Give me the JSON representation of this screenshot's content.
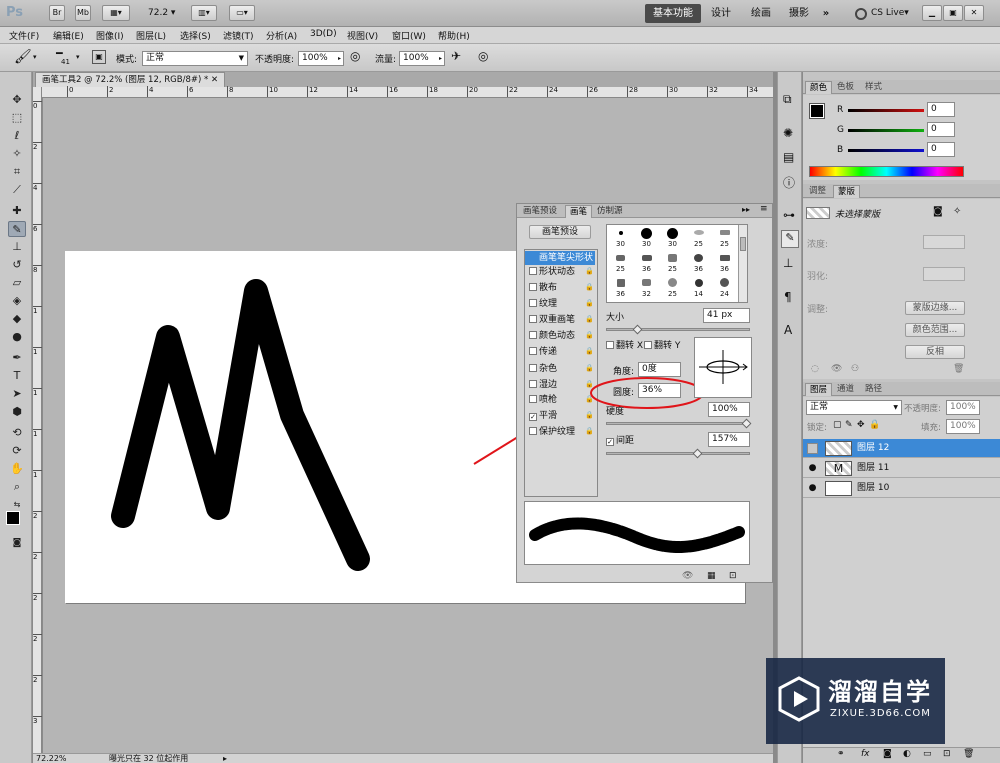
{
  "app": {
    "logo": "Ps",
    "zoom": "72.2",
    "workspaces": [
      "基本功能",
      "设计",
      "绘画",
      "摄影"
    ],
    "more_label": "»",
    "cs_live": "CS Live"
  },
  "menu": [
    "文件(F)",
    "编辑(E)",
    "图像(I)",
    "图层(L)",
    "选择(S)",
    "滤镜(T)",
    "分析(A)",
    "3D(D)",
    "视图(V)",
    "窗口(W)",
    "帮助(H)"
  ],
  "options": {
    "brush_size": "41",
    "mode_label": "模式:",
    "mode_value": "正常",
    "opacity_label": "不透明度:",
    "opacity_value": "100%",
    "flow_label": "流量:",
    "flow_value": "100%"
  },
  "document": {
    "tab_title": "画笔工具2 @ 72.2% (图层 12, RGB/8#) *",
    "ruler_marks": [
      "0",
      "2",
      "4",
      "6",
      "8",
      "10",
      "12",
      "14",
      "16",
      "18",
      "20",
      "22",
      "24",
      "26",
      "28",
      "30",
      "32",
      "34"
    ],
    "vruler_marks": [
      "0",
      "2",
      "4",
      "6",
      "8",
      "1",
      "1",
      "1",
      "1",
      "1",
      "2",
      "2",
      "2",
      "2",
      "2",
      "3"
    ],
    "status_zoom": "72.22%",
    "status_text": "曝光只在 32 位起作用"
  },
  "brush_panel": {
    "tabs": [
      "画笔预设",
      "画笔",
      "仿制源"
    ],
    "presets_button": "画笔预设",
    "options": [
      {
        "label": "画笔笔尖形状",
        "checked": false,
        "selected": true
      },
      {
        "label": "形状动态",
        "checked": false
      },
      {
        "label": "散布",
        "checked": false
      },
      {
        "label": "纹理",
        "checked": false
      },
      {
        "label": "双重画笔",
        "checked": false
      },
      {
        "label": "颜色动态",
        "checked": false
      },
      {
        "label": "传递",
        "checked": false
      },
      {
        "label": "杂色",
        "checked": false
      },
      {
        "label": "湿边",
        "checked": false
      },
      {
        "label": "喷枪",
        "checked": false
      },
      {
        "label": "平滑",
        "checked": true
      },
      {
        "label": "保护纹理",
        "checked": false
      }
    ],
    "tip_sizes": [
      "30",
      "30",
      "30",
      "25",
      "25",
      "25",
      "36",
      "25",
      "36",
      "36",
      "36",
      "32",
      "25",
      "14",
      "24"
    ],
    "size_label": "大小",
    "size_value": "41 px",
    "flip_x": "翻转 X",
    "flip_y": "翻转 Y",
    "angle_label": "角度:",
    "angle_value": "0度",
    "roundness_label": "圆度:",
    "roundness_value": "36%",
    "hardness_label": "硬度",
    "hardness_value": "100%",
    "spacing_label": "间距",
    "spacing_value": "157%",
    "size_fraction": 0.2,
    "hardness_fraction": 1.0,
    "spacing_fraction": 0.64
  },
  "color_panel": {
    "tabs": [
      "颜色",
      "色板",
      "样式"
    ],
    "channels": [
      {
        "label": "R",
        "value": "0",
        "color": "#d01010"
      },
      {
        "label": "G",
        "value": "0",
        "color": "#10b010"
      },
      {
        "label": "B",
        "value": "0",
        "color": "#1010d0"
      }
    ]
  },
  "masks_panel": {
    "tabs": [
      "调整",
      "蒙版"
    ],
    "no_mask": "未选择蒙版",
    "density": "浓度:",
    "feather": "羽化:",
    "refine": "调整:",
    "mask_edge": "蒙版边缘...",
    "color_range": "颜色范围...",
    "invert": "反相"
  },
  "layers_panel": {
    "tabs": [
      "图层",
      "通道",
      "路径"
    ],
    "blend_mode": "正常",
    "opacity_label": "不透明度:",
    "opacity_value": "100%",
    "lock_label": "锁定:",
    "fill_label": "填充:",
    "fill_value": "100%",
    "layers": [
      {
        "name": "图层 12",
        "selected": true,
        "visible": false
      },
      {
        "name": "图层 11",
        "selected": false,
        "visible": true
      },
      {
        "name": "图层 10",
        "selected": false,
        "visible": true
      }
    ]
  },
  "watermark": {
    "title": "溜溜自学",
    "url": "ZIXUE.3D66.COM"
  },
  "colors": {
    "accent": "#3c89d6",
    "annotation": "#e0151a",
    "stroke": "#000000"
  }
}
